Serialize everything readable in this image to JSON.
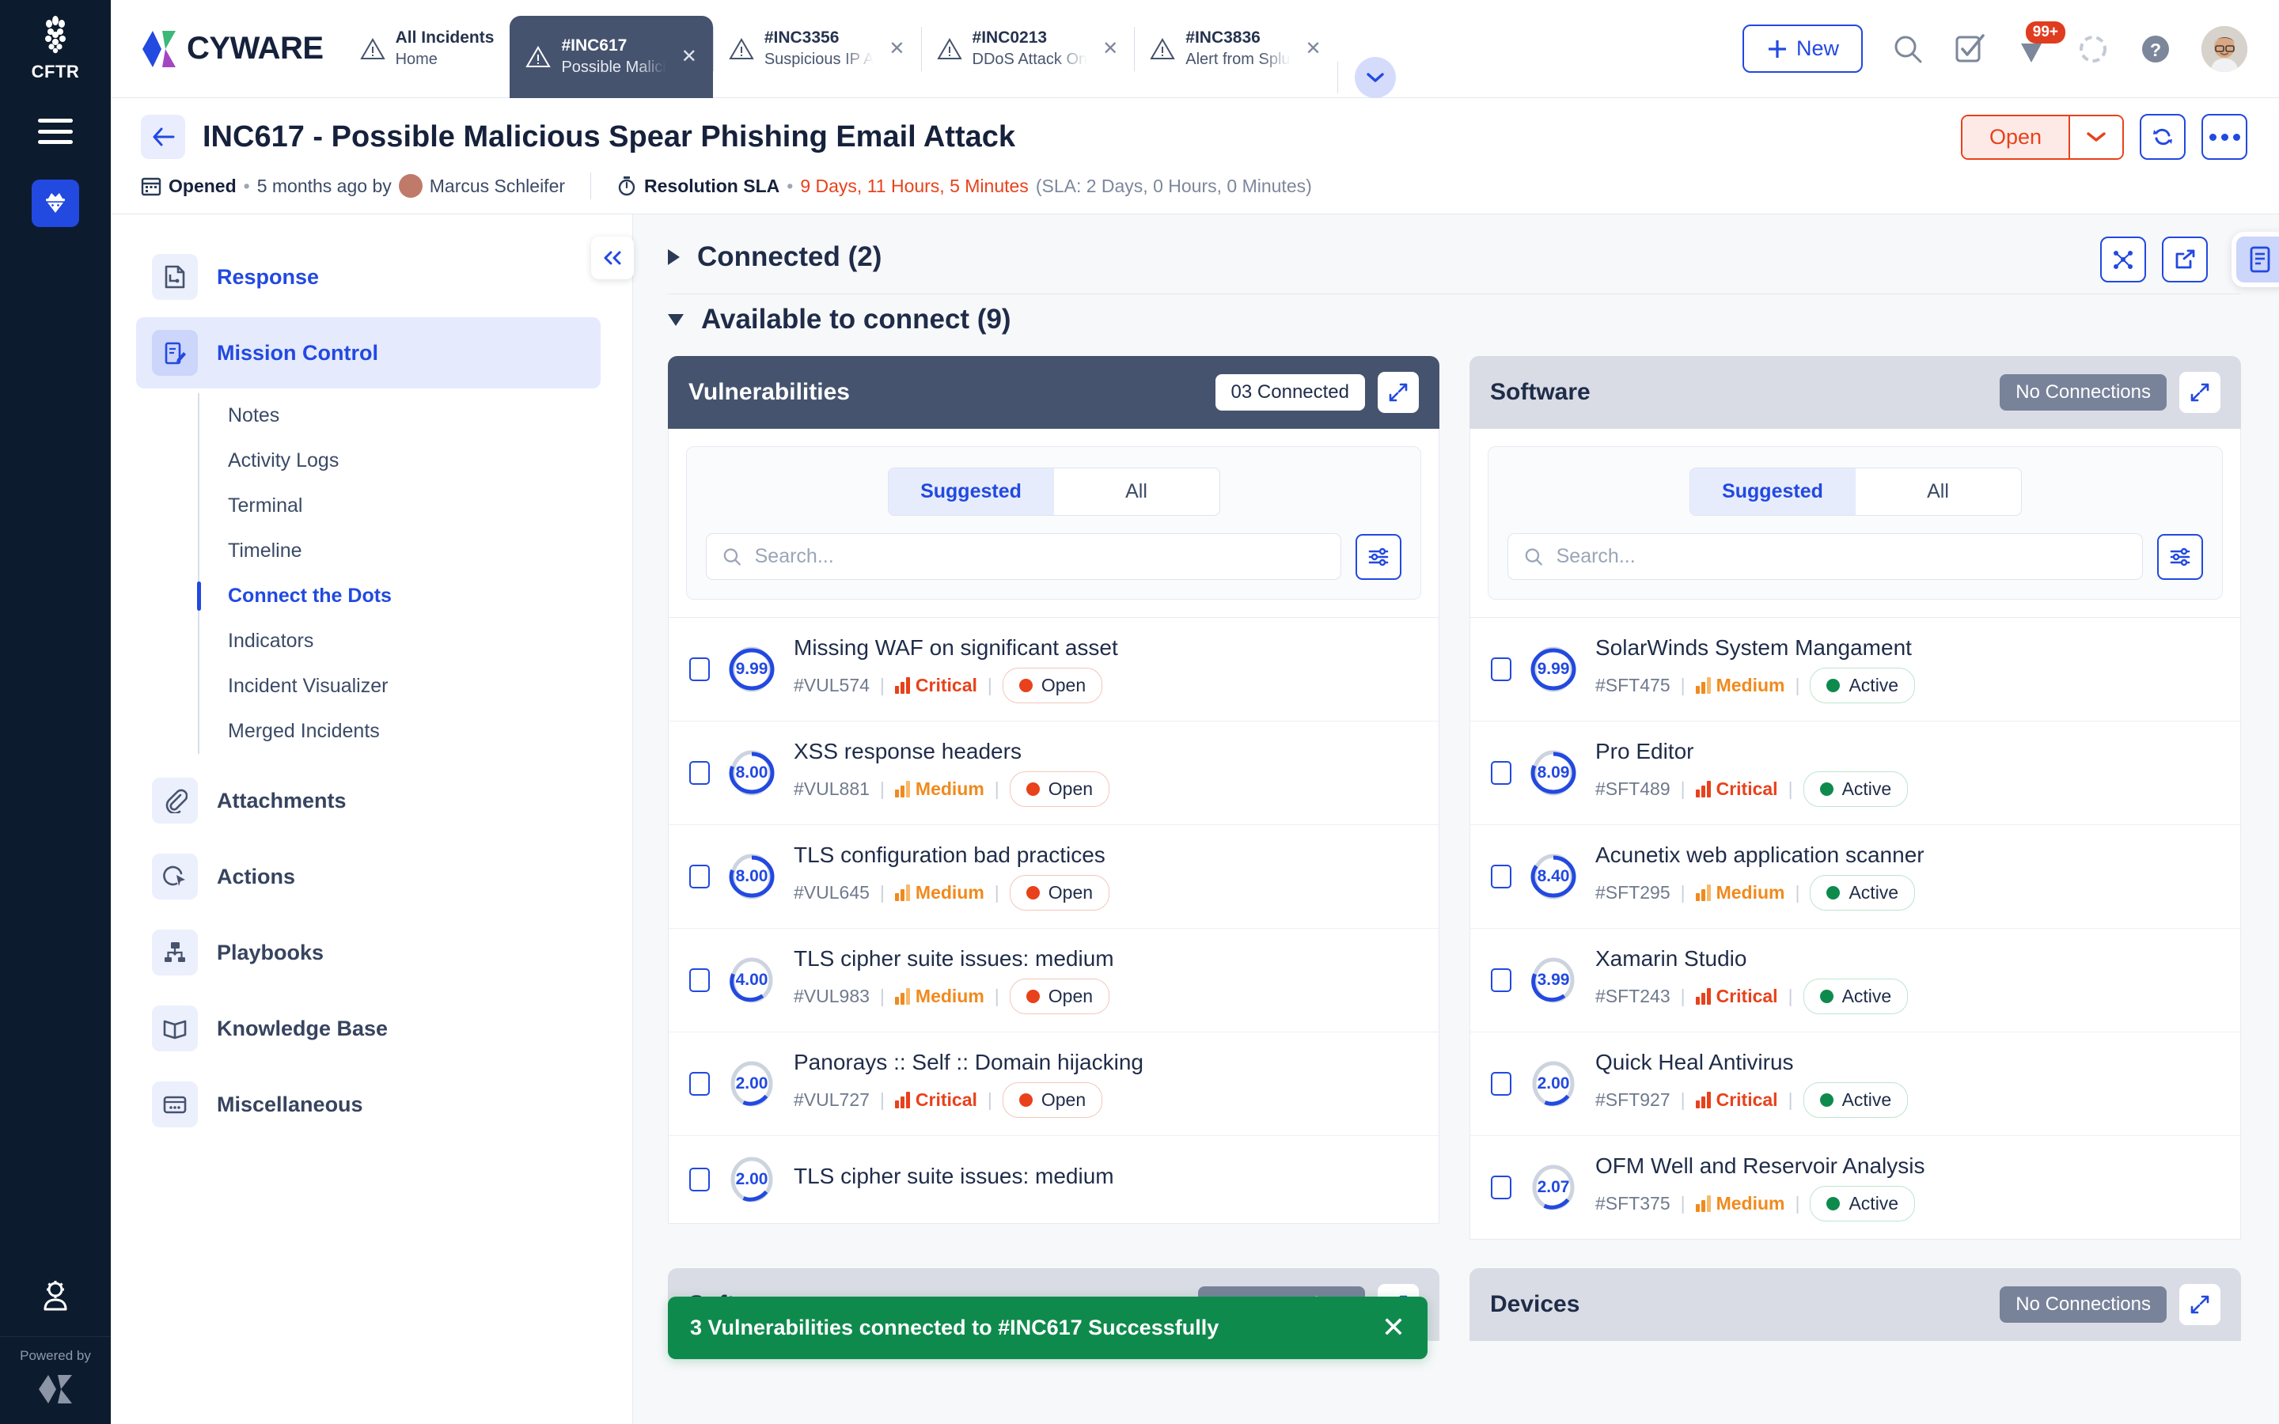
{
  "rail": {
    "product_code": "CFTR",
    "menu_icon": "hamburger-icon",
    "module_icon": "spy-agent-icon",
    "admin_icon": "user-gear-icon",
    "powered_by_label": "Powered by"
  },
  "topbar": {
    "brand": "CYWARE",
    "tabs": [
      {
        "id": "All Incidents",
        "sub": "Home",
        "active": false,
        "closable": false
      },
      {
        "id": "#INC617",
        "sub": "Possible Malici",
        "active": true,
        "closable": true
      },
      {
        "id": "#INC3356",
        "sub": "Suspicious IP A",
        "active": false,
        "closable": true
      },
      {
        "id": "#INC0213",
        "sub": "DDoS Attack On",
        "active": false,
        "closable": true
      },
      {
        "id": "#INC3836",
        "sub": "Alert from Splu",
        "active": false,
        "closable": true
      }
    ],
    "more_tabs_icon": "chevron-down-icon",
    "new_button": "New",
    "icons": {
      "search": "search-icon",
      "tasks": "checklist-icon",
      "notifications": "notification-bell-icon",
      "loading": "loading-spinner-icon",
      "help": "help-circle-icon",
      "avatar": "user-avatar"
    },
    "notification_badge": "99+"
  },
  "incident": {
    "back_icon": "arrow-left-icon",
    "title": "INC617 - Possible Malicious Spear Phishing Email Attack",
    "status": "Open",
    "status_caret_icon": "chevron-down-icon",
    "refresh_icon": "sync-refresh-icon",
    "more_icon": "more-options-icon",
    "meta": {
      "calendar_icon": "calendar-icon",
      "opened_label": "Opened",
      "opened_value": "5 months ago by",
      "owner": "Marcus Schleifer",
      "sla_icon": "stopwatch-icon",
      "sla_label": "Resolution SLA",
      "sla_elapsed": "9 Days, 11 Hours, 5 Minutes",
      "sla_target": "(SLA: 2 Days, 0 Hours, 0 Minutes)"
    }
  },
  "sidebar": {
    "collapse_icon": "chevron-double-left-icon",
    "items": [
      {
        "label": "Response",
        "icon": "response-doc-icon",
        "active": false,
        "blue": true
      },
      {
        "label": "Mission Control",
        "icon": "mission-control-icon",
        "active": true,
        "blue": true
      }
    ],
    "subitems": [
      {
        "label": "Notes",
        "active": false
      },
      {
        "label": "Activity Logs",
        "active": false
      },
      {
        "label": "Terminal",
        "active": false
      },
      {
        "label": "Timeline",
        "active": false
      },
      {
        "label": "Connect the Dots",
        "active": true
      },
      {
        "label": "Indicators",
        "active": false
      },
      {
        "label": "Incident Visualizer",
        "active": false
      },
      {
        "label": "Merged Incidents",
        "active": false
      }
    ],
    "items_bottom": [
      {
        "label": "Attachments",
        "icon": "paperclip-icon"
      },
      {
        "label": "Actions",
        "icon": "action-cursor-icon"
      },
      {
        "label": "Playbooks",
        "icon": "playbook-flow-icon"
      },
      {
        "label": "Knowledge Base",
        "icon": "book-icon"
      },
      {
        "label": "Miscellaneous",
        "icon": "card-dots-icon"
      }
    ]
  },
  "main": {
    "tools": {
      "graph_icon": "node-graph-icon",
      "share_icon": "share-external-icon",
      "panel_icon": "details-panel-icon"
    },
    "sections": [
      {
        "title": "Connected (2)",
        "expanded": false
      },
      {
        "title": "Available to connect (9)",
        "expanded": true
      }
    ],
    "cards": [
      {
        "title": "Vulnerabilities",
        "header_style": "dark",
        "connection_badge": "03 Connected",
        "badge_style": "white",
        "expand_icon": "expand-diagonal-icon",
        "tabs": [
          {
            "label": "Suggested",
            "on": true
          },
          {
            "label": "All",
            "on": false
          }
        ],
        "search_placeholder": "Search...",
        "search_value": "",
        "search_icon": "search-icon",
        "filter_icon": "filter-sliders-icon",
        "rows": [
          {
            "score": "9.99",
            "pct": 100,
            "title": "Missing WAF on significant asset",
            "id": "#VUL574",
            "severity": "Critical",
            "sev_key": "critical",
            "state": "Open",
            "state_key": "open"
          },
          {
            "score": "8.00",
            "pct": 80,
            "title": "XSS response headers",
            "id": "#VUL881",
            "severity": "Medium",
            "sev_key": "medium",
            "state": "Open",
            "state_key": "open"
          },
          {
            "score": "8.00",
            "pct": 80,
            "title": "TLS configuration bad practices",
            "id": "#VUL645",
            "severity": "Medium",
            "sev_key": "medium",
            "state": "Open",
            "state_key": "open"
          },
          {
            "score": "4.00",
            "pct": 40,
            "title": "TLS cipher suite issues: medium",
            "id": "#VUL983",
            "severity": "Medium",
            "sev_key": "medium",
            "state": "Open",
            "state_key": "open"
          },
          {
            "score": "2.00",
            "pct": 20,
            "title": "Panorays :: Self :: Domain hijacking",
            "id": "#VUL727",
            "severity": "Critical",
            "sev_key": "critical",
            "state": "Open",
            "state_key": "open"
          },
          {
            "score": "2.00",
            "pct": 20,
            "title": "TLS cipher suite issues: medium",
            "id": "",
            "severity": "",
            "sev_key": "medium",
            "state": "",
            "state_key": "open"
          }
        ]
      },
      {
        "title": "Software",
        "header_style": "grey",
        "connection_badge": "No Connections",
        "badge_style": "grey",
        "expand_icon": "expand-diagonal-icon",
        "tabs": [
          {
            "label": "Suggested",
            "on": true
          },
          {
            "label": "All",
            "on": false
          }
        ],
        "search_placeholder": "Search...",
        "search_value": "",
        "search_icon": "search-icon",
        "filter_icon": "filter-sliders-icon",
        "rows": [
          {
            "score": "9.99",
            "pct": 100,
            "title": "SolarWinds System Mangament",
            "id": "#SFT475",
            "severity": "Medium",
            "sev_key": "medium",
            "state": "Active",
            "state_key": "active"
          },
          {
            "score": "8.09",
            "pct": 81,
            "title": "Pro Editor",
            "id": "#SFT489",
            "severity": "Critical",
            "sev_key": "critical",
            "state": "Active",
            "state_key": "active"
          },
          {
            "score": "8.40",
            "pct": 84,
            "title": "Acunetix web application scanner",
            "id": "#SFT295",
            "severity": "Medium",
            "sev_key": "medium",
            "state": "Active",
            "state_key": "active"
          },
          {
            "score": "3.99",
            "pct": 40,
            "title": "Xamarin Studio",
            "id": "#SFT243",
            "severity": "Critical",
            "sev_key": "critical",
            "state": "Active",
            "state_key": "active"
          },
          {
            "score": "2.00",
            "pct": 20,
            "title": "Quick Heal Antivirus",
            "id": "#SFT927",
            "severity": "Critical",
            "sev_key": "critical",
            "state": "Active",
            "state_key": "active"
          },
          {
            "score": "2.07",
            "pct": 21,
            "title": "OFM Well and Reservoir Analysis",
            "id": "#SFT375",
            "severity": "Medium",
            "sev_key": "medium",
            "state": "Active",
            "state_key": "active"
          }
        ]
      }
    ],
    "bottom_cards": [
      {
        "title": "Softwares",
        "connection_badge": "No Connections",
        "expand_icon": "expand-diagonal-icon"
      },
      {
        "title": "Devices",
        "connection_badge": "No Connections",
        "expand_icon": "expand-diagonal-icon"
      }
    ]
  },
  "toast": {
    "message": "3 Vulnerabilities connected to #INC617 Successfully",
    "close_icon": "close-icon"
  },
  "colors": {
    "accent": "#2249e0",
    "critical": "#e8411b",
    "medium": "#f08a1d",
    "success": "#0f8a4d",
    "dark_header": "#46536e",
    "rail_bg": "#0d1b2e"
  }
}
